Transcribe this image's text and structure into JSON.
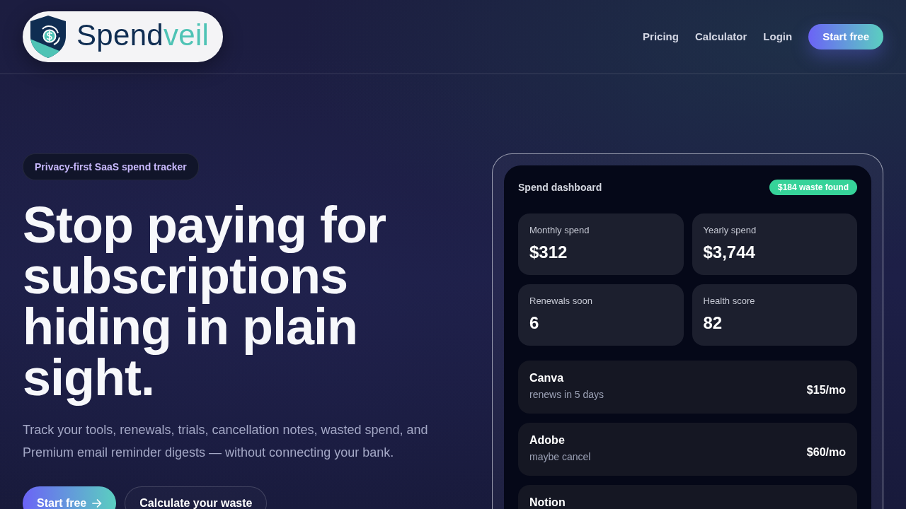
{
  "header": {
    "logo": {
      "name_parts": [
        {
          "text": "Spend",
          "color": "#0f2d52"
        },
        {
          "text": "veil",
          "color": "#4fc3b5"
        }
      ]
    },
    "nav_links": [
      "Pricing",
      "Calculator",
      "Login"
    ],
    "cta_button": "Start free"
  },
  "hero": {
    "badge": "Privacy-first SaaS spend tracker",
    "heading": "Stop paying for subscriptions hiding in plain sight.",
    "description": "Track your tools, renewals, trials, cancellation notes, wasted spend, and Premium email reminder digests — without connecting your bank.",
    "buttons": [
      {
        "label": "Start free",
        "kind": "primary"
      },
      {
        "label": "Calculate your waste",
        "kind": "outline"
      }
    ]
  },
  "dashboard": {
    "title": "Spend dashboard",
    "waste_badge": "$184 waste found",
    "stats": [
      {
        "label": "Monthly spend",
        "value": "$312"
      },
      {
        "label": "Yearly spend",
        "value": "$3,744"
      },
      {
        "label": "Renewals soon",
        "value": "6"
      },
      {
        "label": "Health score",
        "value": "82"
      }
    ],
    "subscriptions": [
      {
        "name": "Canva",
        "note": "renews in 5 days",
        "price": "$15/mo"
      },
      {
        "name": "Adobe",
        "note": "maybe cancel",
        "price": "$60/mo"
      },
      {
        "name": "Notion"
      }
    ]
  }
}
